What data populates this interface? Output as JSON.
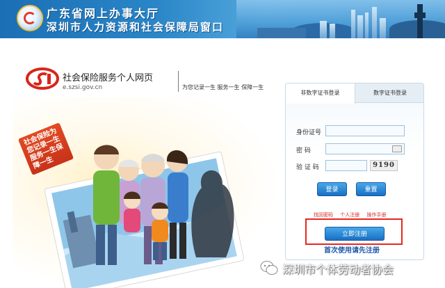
{
  "banner": {
    "line1": "广东省网上办事大厅",
    "line2": "深圳市人力资源和社会保障局窗口"
  },
  "brand": {
    "name": "社会保险服务个人网页",
    "url": "e.szsi.gov.cn",
    "slogan": "为您记录一生  服务一生  保障一生"
  },
  "illustration": {
    "badge_text": "社会保险为您记录一生服务一生保障一生"
  },
  "login": {
    "tabs": [
      "非数字证书登录",
      "数字证书登录"
    ],
    "fields": {
      "id_label": "身份证号",
      "id_value": "",
      "password_label": "密    码",
      "password_value": "",
      "captcha_label": "验 证 码",
      "captcha_value": "",
      "captcha_image_text": "9190"
    },
    "buttons": {
      "login": "登录",
      "reset": "重置"
    },
    "links": [
      "找回密码",
      "个人注册",
      "操作手册"
    ],
    "register_button": "立即注册",
    "register_hint": "首次使用请先注册"
  },
  "watermark": {
    "text": "深圳市个体劳动者协会"
  },
  "colors": {
    "banner_blue": "#1b6fb4",
    "button_blue": "#1a6fc2",
    "link_red": "#d32b20",
    "highlight_red": "#e8261f",
    "hint_blue": "#1a58a8"
  }
}
